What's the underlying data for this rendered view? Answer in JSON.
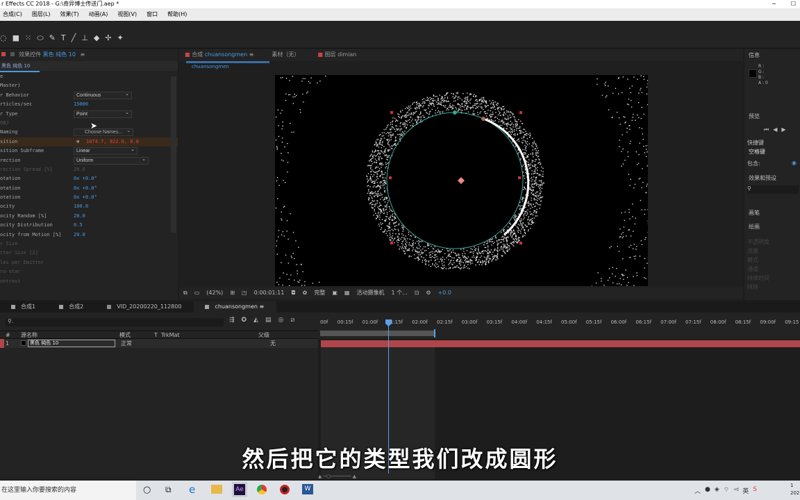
{
  "window": {
    "title": "r Effects CC 2018 - G:\\奇异博士传送门.aep *"
  },
  "menu": [
    "合成(C)",
    "图层(L)",
    "效果(T)",
    "动画(A)",
    "视图(V)",
    "窗口",
    "帮助(H)"
  ],
  "effects_panel": {
    "tab_label": "效果控件",
    "layer_name": "黑色 纯色 10",
    "breadcrumb": "黑色 纯色 10",
    "rows": [
      {
        "name": "e",
        "value": ""
      },
      {
        "name": "Master)",
        "value": ""
      },
      {
        "name": "r Behavior",
        "value": "Continuous",
        "kind": "dropdown"
      },
      {
        "name": "rticles/sec",
        "value": "15000"
      },
      {
        "name": "r Type",
        "value": "Point",
        "kind": "dropdown"
      },
      {
        "name": "OBJ",
        "value": "",
        "dim": true
      },
      {
        "name": "Naming",
        "value": "Choose Names...",
        "kind": "button"
      },
      {
        "name": "sition",
        "value": "1074.7, 922.0, 0.0",
        "kind": "position"
      },
      {
        "name": "sition Subframe",
        "value": "Linear",
        "kind": "dropdown"
      },
      {
        "name": "rection",
        "value": "Uniform",
        "kind": "dropdown"
      },
      {
        "name": "rection Spread [%]",
        "value": "20.0",
        "dim": true
      },
      {
        "name": "otation",
        "value": "0x +0.0°"
      },
      {
        "name": "otation",
        "value": "0x +0.0°"
      },
      {
        "name": "otation",
        "value": "0x +0.0°"
      },
      {
        "name": "ocity",
        "value": "100.0"
      },
      {
        "name": "ocity Random [%]",
        "value": "20.0"
      },
      {
        "name": "ocity Distribution",
        "value": "0.5"
      },
      {
        "name": "ocity from Motion [%]",
        "value": "20.0"
      },
      {
        "name": "r Size",
        "value": "",
        "dim": true
      },
      {
        "name": "tter Size [Z]",
        "value": "",
        "dim": true
      },
      {
        "name": "les per Emitter",
        "value": "",
        "dim": true
      },
      {
        "name": "ro-star",
        "value": "",
        "dim": true
      },
      {
        "name": "ontrast",
        "value": "",
        "dim": true
      }
    ]
  },
  "comp_panel": {
    "tabs": [
      {
        "label": "合成",
        "name": "chuansongmen",
        "active": true
      },
      {
        "label": "素材（无）"
      },
      {
        "label": "图层 dimian"
      }
    ],
    "subtab": "chuansongmen",
    "footer": {
      "zoom": "(42%)",
      "time": "0:00:01:11",
      "resolution": "完整",
      "camera": "活动摄像机",
      "views": "1 个...",
      "exposure": "+0.0"
    }
  },
  "right_panel": {
    "info_title": "信息",
    "rgba": [
      "R :",
      "G :",
      "B :",
      "A : 0"
    ],
    "preview_title": "预览",
    "shortcut_label": "快捷键",
    "shortcut_value": "空格键",
    "include_label": "包含:",
    "effects_presets": "效果和预设",
    "paragraph": "画笔",
    "library": "绘画",
    "faded": [
      "不透明度",
      "流量",
      "模式",
      "通道",
      "持续时间",
      "抹除"
    ]
  },
  "timeline": {
    "tabs": [
      {
        "label": "合成1",
        "color": "#a4a4a4"
      },
      {
        "label": "合成2",
        "color": "#a4a4a4"
      },
      {
        "label": "VID_20200220_112800",
        "color": "#8a8a8a"
      },
      {
        "label": "chuansongmen",
        "color": "#a4a4a4",
        "active": true
      }
    ],
    "columns": {
      "source": "源名称",
      "mode": "模式",
      "t": "T",
      "trkmat": "TrkMat",
      "parent": "父级"
    },
    "layer": {
      "index": "1",
      "name": "黑色 纯色 10",
      "mode": "正常",
      "parent": "无"
    },
    "ruler": [
      "00f",
      "00:15f",
      "01:00f",
      "01:15f",
      "02:00f",
      "02:15f",
      "03:00f",
      "03:15f",
      "04:00f",
      "04:15f",
      "05:00f",
      "05:15f",
      "06:00f",
      "06:15f",
      "07:00f",
      "07:15f",
      "08:00f",
      "08:15f",
      "09:00f",
      "09:15"
    ]
  },
  "taskbar": {
    "search_placeholder": "在这里输入你要搜索的内容",
    "lang": "英",
    "clock_top": "1",
    "clock_bottom": "202"
  },
  "subtitle": "然后把它的类型我们改成圆形",
  "colors": {
    "accent": "#4a9bde",
    "red_track": "#b0454b",
    "playhead": "#5aa0e8"
  }
}
